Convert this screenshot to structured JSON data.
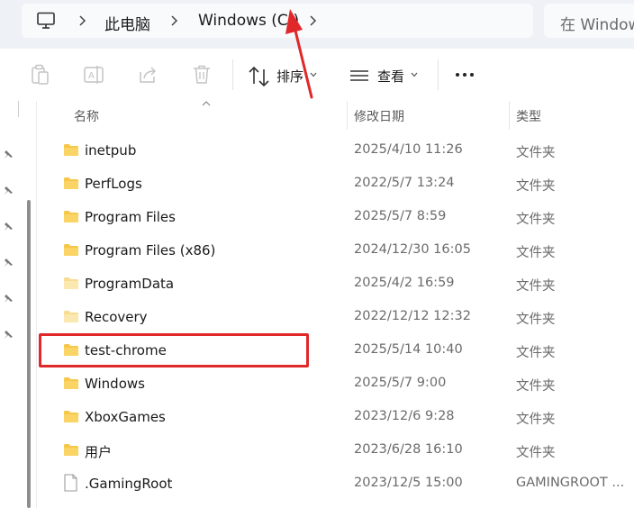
{
  "address_bar": {
    "crumbs": [
      "此电脑",
      "Windows (C:)"
    ],
    "search_placeholder": "在 Windows"
  },
  "toolbar": {
    "sort_label": "排序",
    "view_label": "查看"
  },
  "columns": {
    "name": "名称",
    "modified": "修改日期",
    "type": "类型"
  },
  "files": [
    {
      "name": "inetpub",
      "modified": "2025/4/10 11:26",
      "type": "文件夹",
      "kind": "folder"
    },
    {
      "name": "PerfLogs",
      "modified": "2022/5/7 13:24",
      "type": "文件夹",
      "kind": "folder"
    },
    {
      "name": "Program Files",
      "modified": "2025/5/7 8:59",
      "type": "文件夹",
      "kind": "folder"
    },
    {
      "name": "Program Files (x86)",
      "modified": "2024/12/30 16:05",
      "type": "文件夹",
      "kind": "folder"
    },
    {
      "name": "ProgramData",
      "modified": "2025/4/2 16:59",
      "type": "文件夹",
      "kind": "folder-light"
    },
    {
      "name": "Recovery",
      "modified": "2022/12/12 12:32",
      "type": "文件夹",
      "kind": "folder-light"
    },
    {
      "name": "test-chrome",
      "modified": "2025/5/14 10:40",
      "type": "文件夹",
      "kind": "folder"
    },
    {
      "name": "Windows",
      "modified": "2025/5/7 9:00",
      "type": "文件夹",
      "kind": "folder"
    },
    {
      "name": "XboxGames",
      "modified": "2023/12/6 9:28",
      "type": "文件夹",
      "kind": "folder"
    },
    {
      "name": "用户",
      "modified": "2023/6/28 16:10",
      "type": "文件夹",
      "kind": "folder"
    },
    {
      "name": ".GamingRoot",
      "modified": "2023/12/5 15:00",
      "type": "GAMINGROOT ...",
      "kind": "file"
    }
  ],
  "colors": {
    "folder": "#f6c84a",
    "folder_light": "#fbe3a0",
    "highlight": "#e0282a"
  }
}
